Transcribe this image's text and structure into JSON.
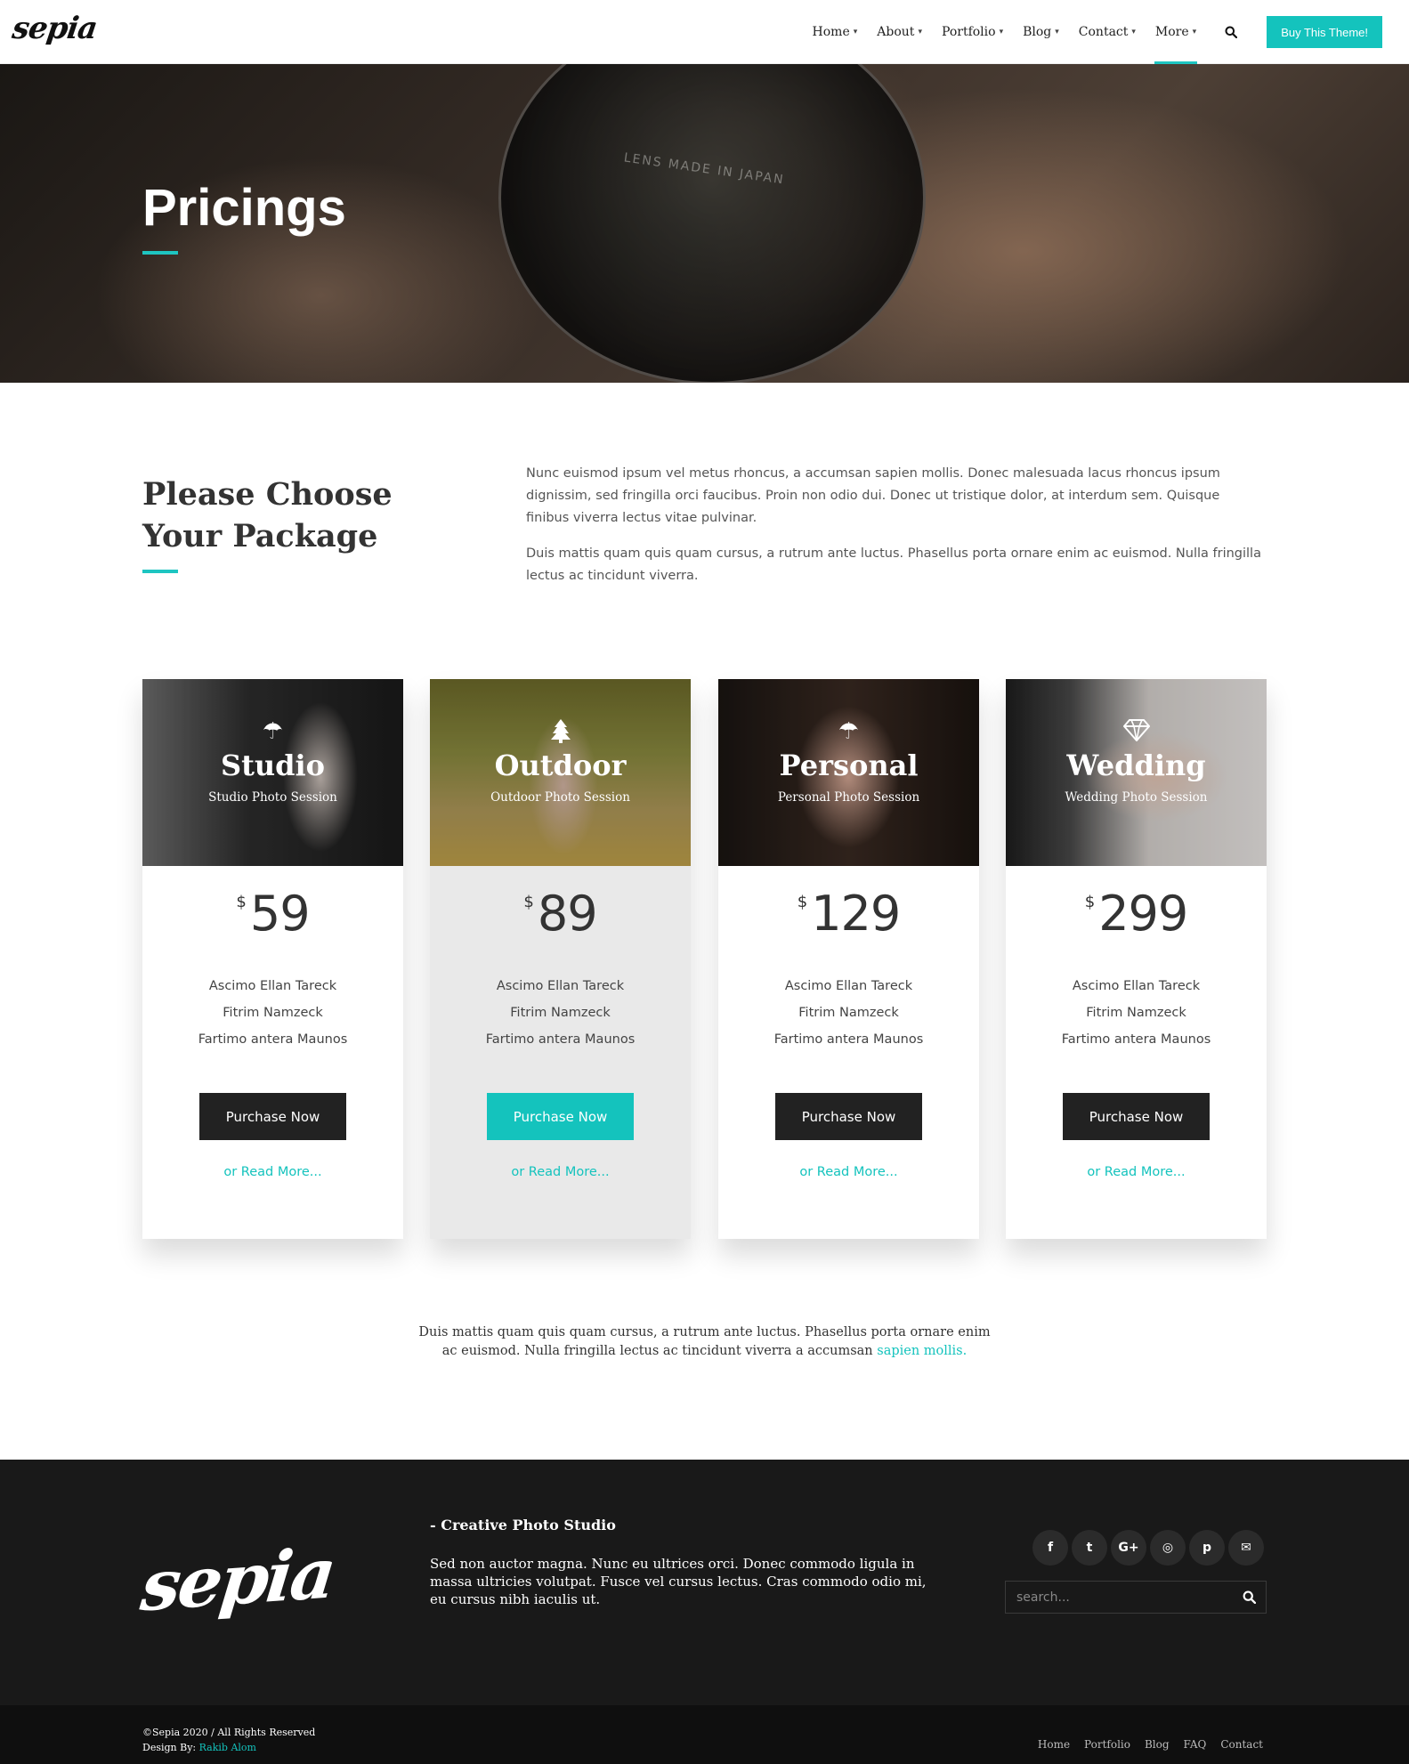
{
  "brand": {
    "logo_text": "sepia"
  },
  "nav": {
    "items": [
      {
        "label": "Home"
      },
      {
        "label": "About"
      },
      {
        "label": "Portfolio"
      },
      {
        "label": "Blog"
      },
      {
        "label": "Contact"
      },
      {
        "label": "More"
      }
    ],
    "active": "More",
    "cta_label": "Buy This Theme!"
  },
  "hero": {
    "title": "Pricings",
    "lens_text": "LENS MADE IN JAPAN"
  },
  "intro": {
    "title": "Please Choose Your Package",
    "paragraph_1": "Nunc euismod ipsum vel metus rhoncus, a accumsan sapien mollis. Donec malesuada lacus rhoncus ipsum dignissim, sed fringilla orci faucibus. Proin non odio dui. Donec ut tristique dolor, at interdum sem. Quisque finibus viverra lectus vitae pulvinar.",
    "paragraph_2": "Duis mattis quam quis quam cursus, a rutrum ante luctus. Phasellus porta ornare enim ac euismod. Nulla fringilla lectus ac tincidunt viverra."
  },
  "plans": [
    {
      "name": "Studio",
      "subtitle": "Studio Photo Session",
      "icon": "umbrella-icon",
      "currency": "$",
      "price": "59",
      "features": [
        "Ascimo Ellan Tareck",
        "Fitrim Namzeck",
        "Fartimo antera Maunos"
      ],
      "button": "Purchase Now",
      "read_more": "or Read More...",
      "featured": false
    },
    {
      "name": "Outdoor",
      "subtitle": "Outdoor Photo Session",
      "icon": "tree-icon",
      "currency": "$",
      "price": "89",
      "features": [
        "Ascimo Ellan Tareck",
        "Fitrim Namzeck",
        "Fartimo antera Maunos"
      ],
      "button": "Purchase Now",
      "read_more": "or Read More...",
      "featured": true
    },
    {
      "name": "Personal",
      "subtitle": "Personal Photo Session",
      "icon": "umbrella-icon",
      "currency": "$",
      "price": "129",
      "features": [
        "Ascimo Ellan Tareck",
        "Fitrim Namzeck",
        "Fartimo antera Maunos"
      ],
      "button": "Purchase Now",
      "read_more": "or Read More...",
      "featured": false
    },
    {
      "name": "Wedding",
      "subtitle": "Wedding Photo Session",
      "icon": "diamond-icon",
      "currency": "$",
      "price": "299",
      "features": [
        "Ascimo Ellan Tareck",
        "Fitrim Namzeck",
        "Fartimo antera Maunos"
      ],
      "button": "Purchase Now",
      "read_more": "or Read More...",
      "featured": false
    }
  ],
  "bottom_note": {
    "text": "Duis mattis quam quis quam cursus, a rutrum ante luctus. Phasellus porta ornare enim ac euismod. Nulla fringilla lectus ac tincidunt viverra a accumsan ",
    "link": "sapien mollis."
  },
  "footer": {
    "logo_text": "sepia",
    "heading": "- Creative Photo Studio",
    "text": "Sed non auctor magna. Nunc eu ultrices orci. Donec commodo ligula in massa ultricies volutpat. Fusce vel cursus lectus. Cras commodo odio mi, eu cursus nibh iaculis ut.",
    "social": [
      {
        "icon": "facebook-icon",
        "glyph": "f"
      },
      {
        "icon": "twitter-icon",
        "glyph": "t"
      },
      {
        "icon": "google-plus-icon",
        "glyph": "G+"
      },
      {
        "icon": "instagram-icon",
        "glyph": "◎"
      },
      {
        "icon": "pinterest-icon",
        "glyph": "p"
      },
      {
        "icon": "envelope-icon",
        "glyph": "✉"
      }
    ],
    "search_placeholder": "search..."
  },
  "subfooter": {
    "copyright": "©Sepia 2020 / All Rights Reserved",
    "design_by_label": "Design By: ",
    "design_by_name": "Rakib Alom",
    "links": [
      "Home",
      "Portfolio",
      "Blog",
      "FAQ",
      "Contact"
    ]
  },
  "colors": {
    "accent": "#14c3bd",
    "dark": "#222222",
    "footer_bg": "#191919"
  }
}
